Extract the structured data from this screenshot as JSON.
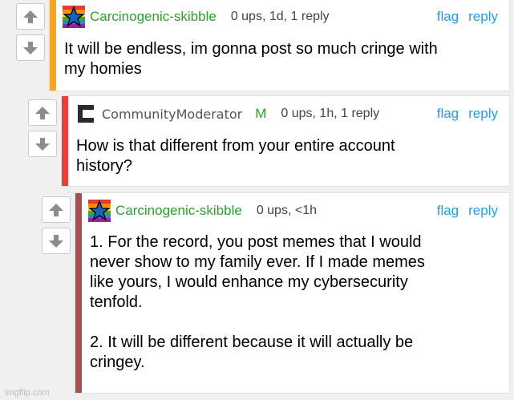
{
  "vote_controls": {
    "upvote_icon": "arrow-up-icon",
    "downvote_icon": "arrow-down-icon"
  },
  "comments": [
    {
      "username": "Carcinogenic-skibble",
      "username_color": "#2e9e2e",
      "avatar": "rainbow-star-avatar",
      "meta": "0 ups, 1d, 1 reply",
      "flag": "flag",
      "reply": "reply",
      "body": "It will be endless, im gonna post so much cringe with\nmy homies",
      "accent_color": "#f5a623"
    },
    {
      "username": "CommunityModerator",
      "username_color": "#555555",
      "avatar": "bracket-logo-avatar",
      "badge": "M",
      "meta": "0 ups, 1h, 1 reply",
      "flag": "flag",
      "reply": "reply",
      "body": "How is that different from your entire account\nhistory?",
      "accent_color": "#ef3b3b"
    },
    {
      "username": "Carcinogenic-skibble",
      "username_color": "#2e9e2e",
      "avatar": "rainbow-star-avatar",
      "meta": "0 ups, <1h",
      "flag": "flag",
      "reply": "reply",
      "body": "1. For the record, you post memes that I would\nnever show to my family ever. If I made memes\nlike yours, I would enhance my cybersecurity\ntenfold.\n\n2. It will be different because it will actually be\ncringey.",
      "accent_color": "#a05252"
    }
  ],
  "watermark": "imgflip.com"
}
